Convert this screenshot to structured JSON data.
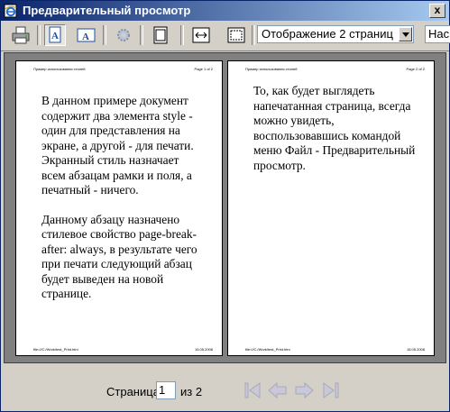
{
  "window": {
    "title": "Предварительный просмотр",
    "close_label": "x"
  },
  "toolbar": {
    "buttons": [
      {
        "name": "print-button",
        "icon": "printer-icon"
      },
      {
        "name": "portrait-button",
        "icon": "portrait-page-icon",
        "pressed": true
      },
      {
        "name": "landscape-button",
        "icon": "landscape-page-icon"
      },
      {
        "name": "page-setup-button",
        "icon": "gear-icon"
      },
      {
        "name": "full-page-button",
        "icon": "full-page-icon"
      },
      {
        "name": "page-width-button",
        "icon": "page-width-icon"
      },
      {
        "name": "whole-page-button",
        "icon": "whole-page-icon"
      }
    ],
    "view_select": "Отображение 2 страниц",
    "zoom_select": "Нас"
  },
  "pages": [
    {
      "header_left": "Пример использования стилей",
      "header_right": "Page 1 of 2",
      "paragraphs": [
        "В данном примере документ содержит два элемента style - один для представления на экране, а другой - для печати. Экранный стиль назначает всем абзацам рамки и поля, а печатный - ничего.",
        "Данному абзацу назначено стилевое свойство page-break-after: always, в результате чего при печати следующий абзац будет выведен на новой странице."
      ],
      "footer_left": "file:///C:/Work/test_Print.htm",
      "footer_right": "15.05.2008"
    },
    {
      "header_left": "Пример использования стилей",
      "header_right": "Page 2 of 2",
      "paragraphs": [
        "То, как будет выглядеть напечатанная страница, всегда можно увидеть, воспользовавшись командой меню Файл - Предварительный просмотр."
      ],
      "footer_left": "file:///C:/Work/test_Print.htm",
      "footer_right": "15.05.2008"
    }
  ],
  "pager": {
    "label": "Страница",
    "current": "1",
    "total": "из 2"
  },
  "colors": {
    "title_bar_start": "#0a246a",
    "title_bar_end": "#a6caf0",
    "face": "#d4d0c8",
    "preview_background": "#808080"
  }
}
